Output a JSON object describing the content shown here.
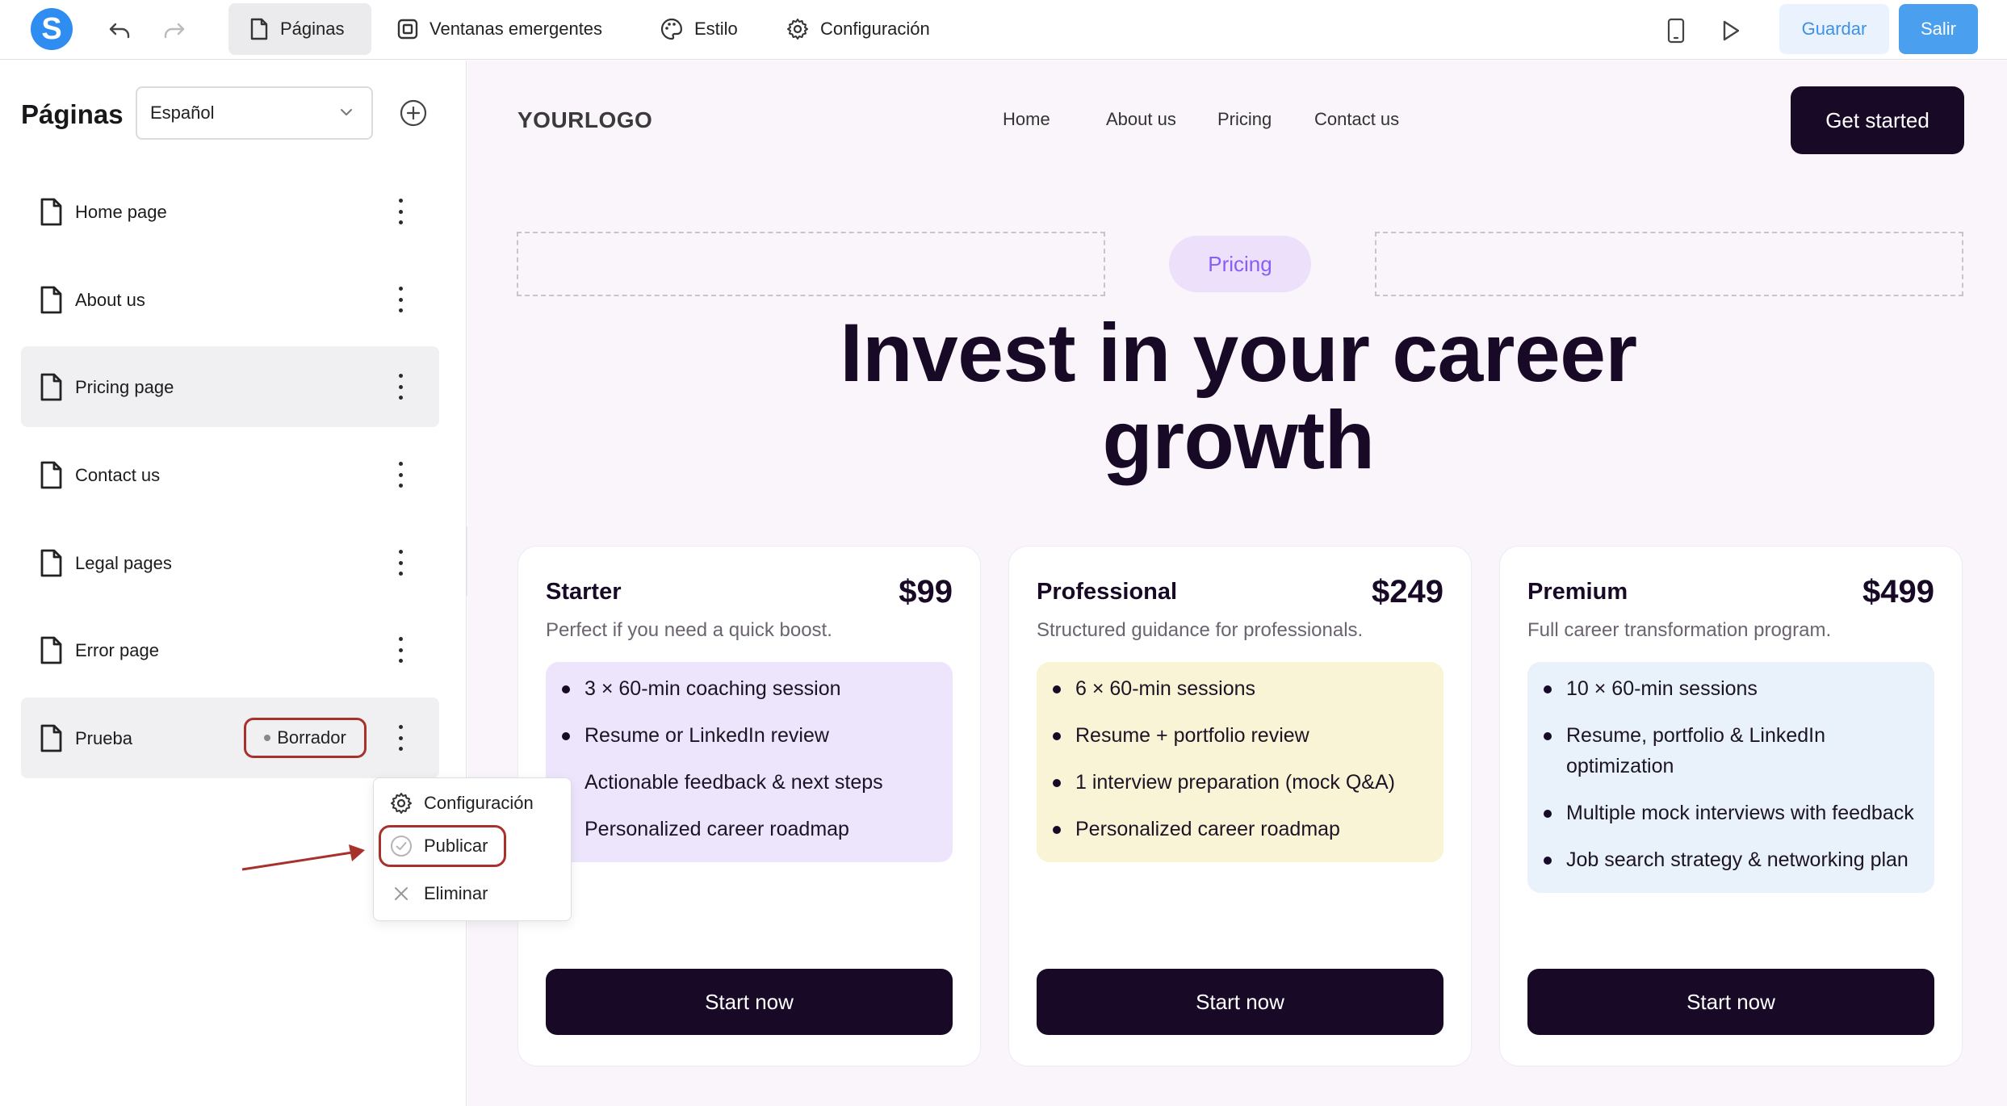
{
  "toolbar": {
    "logo_letter": "S",
    "tabs": [
      {
        "label": "Páginas",
        "icon": "file-icon",
        "active": true
      },
      {
        "label": "Ventanas emergentes",
        "icon": "popup-icon",
        "active": false
      },
      {
        "label": "Estilo",
        "icon": "palette-icon",
        "active": false
      },
      {
        "label": "Configuración",
        "icon": "gear-icon",
        "active": false
      }
    ],
    "save_label": "Guardar",
    "exit_label": "Salir"
  },
  "sidebar": {
    "title": "Páginas",
    "language": "Español",
    "pages": [
      {
        "label": "Home page"
      },
      {
        "label": "About us"
      },
      {
        "label": "Pricing page",
        "selected": true
      },
      {
        "label": "Contact us"
      },
      {
        "label": "Legal pages"
      },
      {
        "label": "Error page"
      },
      {
        "label": "Prueba",
        "badge": "Borrador",
        "selected": true
      }
    ],
    "context_menu": {
      "items": [
        {
          "label": "Configuración",
          "icon": "gear-icon"
        },
        {
          "label": "Publicar",
          "icon": "check-circle-icon"
        },
        {
          "label": "Eliminar",
          "icon": "close-icon"
        }
      ]
    }
  },
  "site": {
    "logo": "YOURLOGO",
    "nav": [
      "Home",
      "About us",
      "Pricing",
      "Contact us"
    ],
    "cta": "Get started",
    "pill": "Pricing",
    "hero_line1": "Invest in your career",
    "hero_line2": "growth",
    "plans": [
      {
        "name": "Starter",
        "price": "$99",
        "desc": "Perfect if you need a quick boost.",
        "color": "#ede5fb",
        "features": [
          "3 × 60-min coaching session",
          "Resume or LinkedIn review",
          "Actionable feedback & next steps",
          "Personalized career roadmap"
        ],
        "cta": "Start now"
      },
      {
        "name": "Professional",
        "price": "$249",
        "desc": "Structured guidance for professionals.",
        "color": "#faf4d7",
        "features": [
          "6 × 60-min sessions",
          "Resume + portfolio review",
          "1 interview preparation (mock Q&A)",
          "Personalized career roadmap"
        ],
        "cta": "Start now"
      },
      {
        "name": "Premium",
        "price": "$499",
        "desc": "Full career transformation program.",
        "color": "#e9f1fb",
        "features": [
          "10 × 60-min sessions",
          "Resume, portfolio & LinkedIn optimization",
          "Multiple mock interviews with feedback",
          "Job search strategy & networking plan"
        ],
        "cta": "Start now"
      }
    ]
  },
  "colors": {
    "brand_blue": "#2f8cf0",
    "dark_navy": "#180a26",
    "annotation_red": "#a7322b",
    "accent_purple": "#8b5cf6"
  }
}
